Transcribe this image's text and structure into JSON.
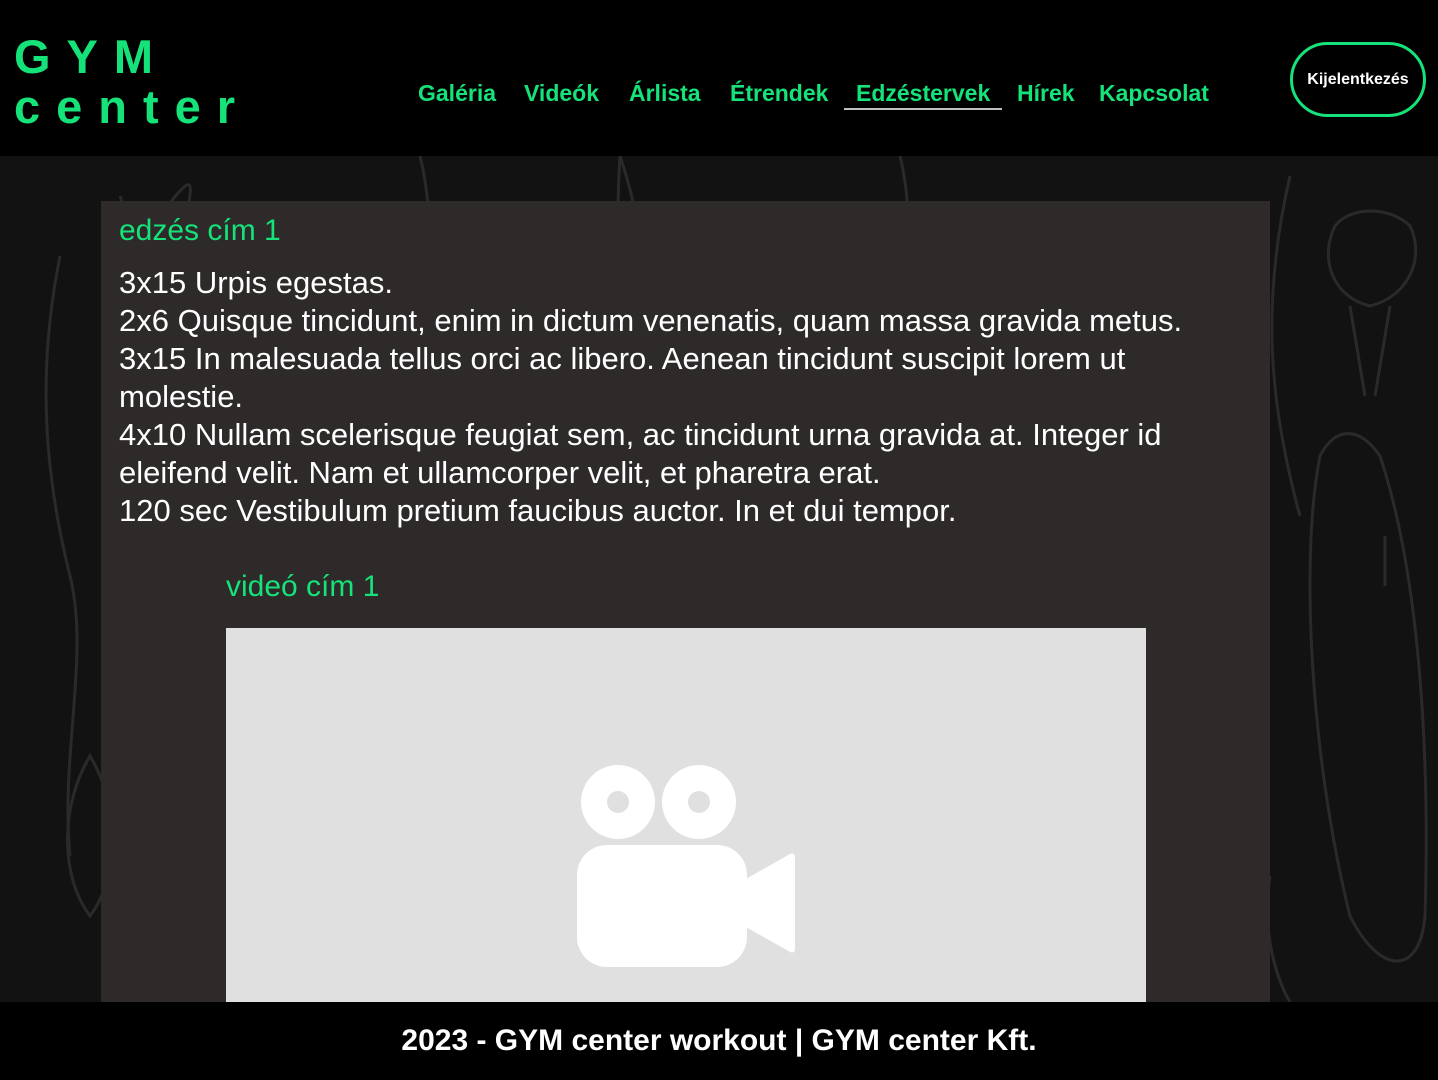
{
  "logo": {
    "line1": "GYM",
    "line2": "center"
  },
  "nav": {
    "items": [
      {
        "label": "Galéria"
      },
      {
        "label": "Videók"
      },
      {
        "label": "Árlista"
      },
      {
        "label": "Étrendek"
      },
      {
        "label": "Edzéstervek",
        "active": true
      },
      {
        "label": "Hírek"
      },
      {
        "label": "Kapcsolat"
      }
    ],
    "logout_label": "Kijelentkezés"
  },
  "workout": {
    "title": "edzés cím 1",
    "lines": [
      "3x15 Urpis egestas.",
      "2x6 Quisque tincidunt, enim in dictum venenatis, quam massa gravida metus.",
      "3x15 In malesuada tellus orci ac libero. Aenean tincidunt suscipit lorem ut molestie.",
      "4x10 Nullam scelerisque feugiat sem, ac tincidunt urna gravida at. Integer id eleifend velit. Nam et ullamcorper velit, et pharetra erat.",
      "120 sec Vestibulum pretium faucibus auctor. In et dui tempor."
    ]
  },
  "video": {
    "title": "videó cím 1",
    "icon": "video-camera-icon"
  },
  "footer": {
    "text": "2023 - GYM center workout | GYM center Kft."
  },
  "colors": {
    "accent": "#16e27a",
    "header_bg": "#000000",
    "card_bg": "#2d2a29",
    "video_placeholder": "#e0e0e0"
  }
}
